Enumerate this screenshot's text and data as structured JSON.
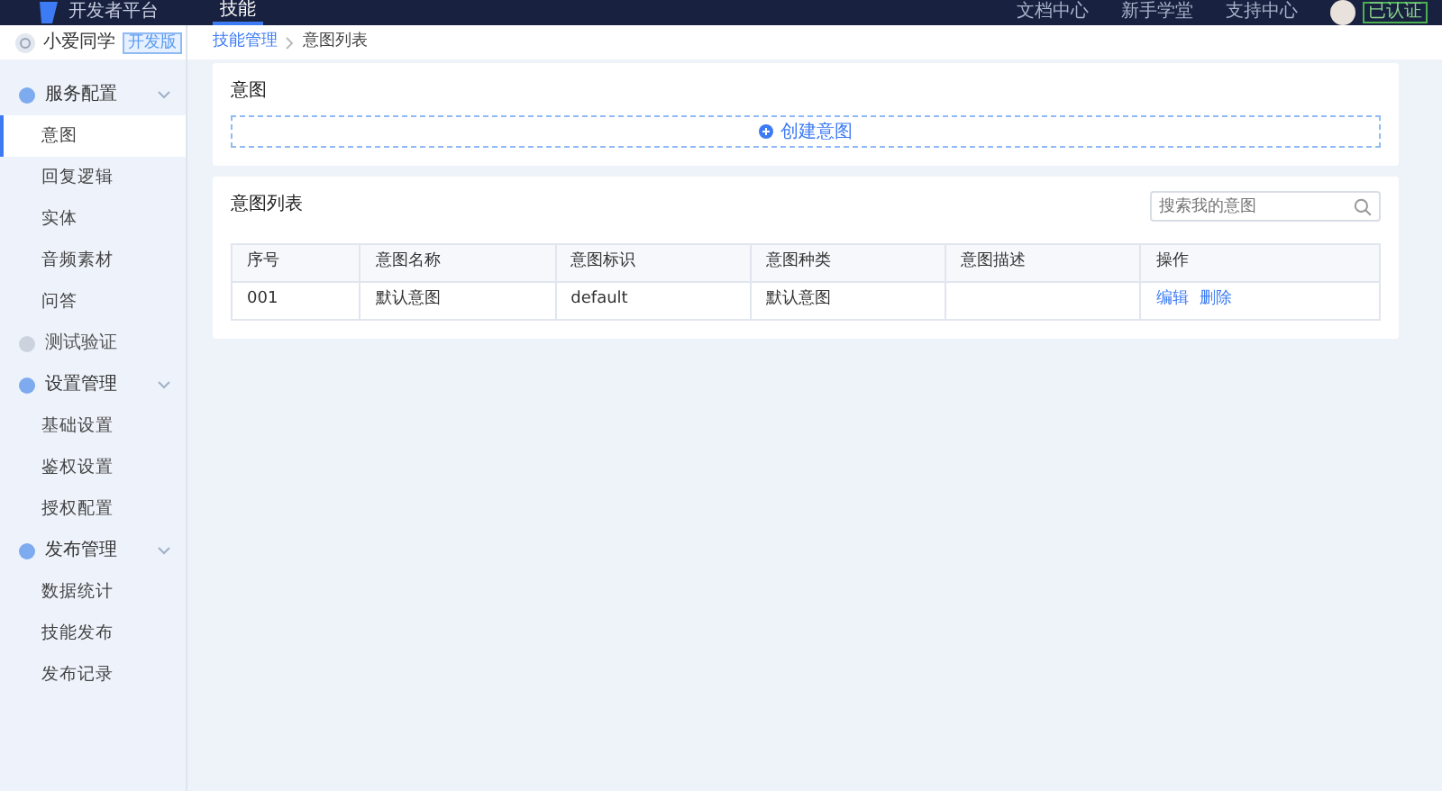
{
  "topbar": {
    "platform": "开发者平台",
    "tabs": [
      {
        "label": "技能",
        "selected": true
      }
    ],
    "links": [
      "文档中心",
      "新手学堂",
      "支持中心"
    ],
    "verified": "已认证"
  },
  "sidebar": {
    "app_name": "小爱同学",
    "badge": "开发版",
    "groups": [
      {
        "label": "服务配置",
        "expanded": true,
        "children": [
          {
            "label": "意图",
            "selected": true
          },
          {
            "label": "回复逻辑",
            "selected": false
          },
          {
            "label": "实体",
            "selected": false
          },
          {
            "label": "音频素材",
            "selected": false
          },
          {
            "label": "问答",
            "selected": false
          }
        ]
      },
      {
        "label": "测试验证"
      },
      {
        "label": "设置管理",
        "expanded": true,
        "children": [
          {
            "label": "基础设置",
            "selected": false
          },
          {
            "label": "鉴权设置",
            "selected": false
          },
          {
            "label": "授权配置",
            "selected": false
          }
        ]
      },
      {
        "label": "发布管理",
        "expanded": true,
        "children": [
          {
            "label": "数据统计",
            "selected": false
          },
          {
            "label": "技能发布",
            "selected": false
          },
          {
            "label": "发布记录",
            "selected": false
          }
        ]
      }
    ]
  },
  "breadcrumb": [
    "技能管理",
    "意图列表"
  ],
  "intent_card": {
    "title": "意图",
    "create_button": "创建意图"
  },
  "list_card": {
    "title": "意图列表",
    "search": {
      "placeholder": "搜索我的意图"
    },
    "table": {
      "columns": [
        "序号",
        "意图名称",
        "意图标识",
        "意图种类",
        "意图描述",
        "操作"
      ],
      "rows": [
        {
          "cells": [
            "001",
            "默认意图",
            "default",
            "默认意图",
            ""
          ],
          "actions": [
            "编辑",
            "删除"
          ]
        }
      ]
    }
  }
}
